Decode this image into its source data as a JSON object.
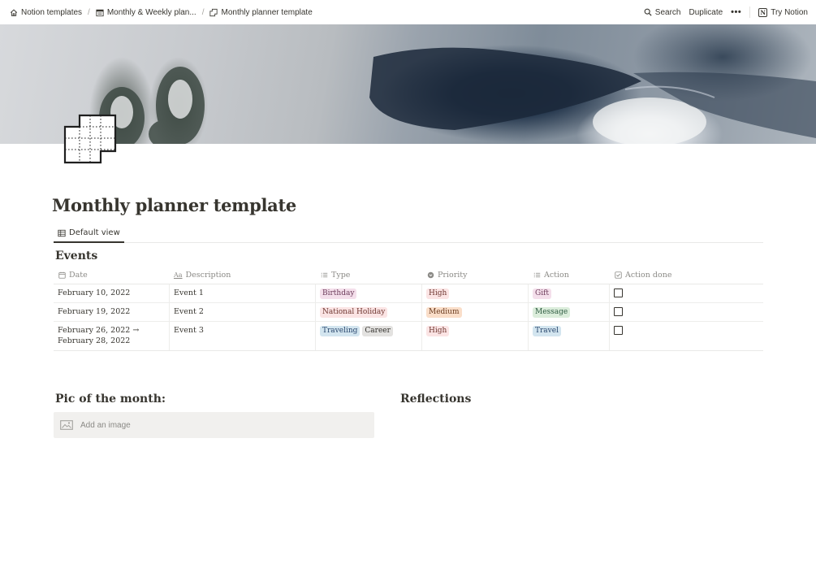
{
  "topbar": {
    "breadcrumbs": [
      {
        "label": "Notion templates",
        "icon": "home-icon"
      },
      {
        "label": "Monthly & Weekly plan...",
        "icon": "calendar-icon"
      },
      {
        "label": "Monthly planner template",
        "icon": "planner-icon"
      }
    ],
    "separator": "/",
    "search_label": "Search",
    "duplicate_label": "Duplicate",
    "more_label": "•••",
    "try_label": "Try Notion",
    "notion_logo_letter": "N"
  },
  "page": {
    "title": "Monthly planner template",
    "view_tab": "Default view",
    "events_title": "Events"
  },
  "table": {
    "columns": [
      {
        "label": "Date",
        "icon": "calendar-icon"
      },
      {
        "label": "Description",
        "icon": "text-icon"
      },
      {
        "label": "Type",
        "icon": "list-icon"
      },
      {
        "label": "Priority",
        "icon": "select-icon"
      },
      {
        "label": "Action",
        "icon": "list-icon"
      },
      {
        "label": "Action done",
        "icon": "checkbox-icon"
      }
    ],
    "rows": [
      {
        "date": "February 10, 2022",
        "description": "Event 1",
        "type": [
          {
            "label": "Birthday",
            "bg": "#f4dfeb",
            "fg": "#6c3b5a"
          }
        ],
        "priority": {
          "label": "High",
          "bg": "#fbe4e4",
          "fg": "#6e3630"
        },
        "action": [
          {
            "label": "Gift",
            "bg": "#f4dfeb",
            "fg": "#6c3b5a"
          }
        ],
        "action_done": false
      },
      {
        "date": "February 19, 2022",
        "description": "Event 2",
        "type": [
          {
            "label": "National Holiday",
            "bg": "#fbe4e4",
            "fg": "#6e3630"
          }
        ],
        "priority": {
          "label": "Medium",
          "bg": "#fadec9",
          "fg": "#6a3b1f"
        },
        "action": [
          {
            "label": "Message",
            "bg": "#dbeddb",
            "fg": "#2b593f"
          }
        ],
        "action_done": false
      },
      {
        "date": "February 26, 2022 → February 28, 2022",
        "description": "Event 3",
        "type": [
          {
            "label": "Traveling",
            "bg": "#d3e5ef",
            "fg": "#28456c"
          },
          {
            "label": "Career",
            "bg": "#e3e2e0",
            "fg": "#32302c"
          }
        ],
        "priority": {
          "label": "High",
          "bg": "#fbe4e4",
          "fg": "#6e3630"
        },
        "action": [
          {
            "label": "Travel",
            "bg": "#d3e5ef",
            "fg": "#28456c"
          }
        ],
        "action_done": false
      }
    ]
  },
  "bottom": {
    "pic_title": "Pic of the month:",
    "reflections_title": "Reflections",
    "add_image_label": "Add an image"
  }
}
